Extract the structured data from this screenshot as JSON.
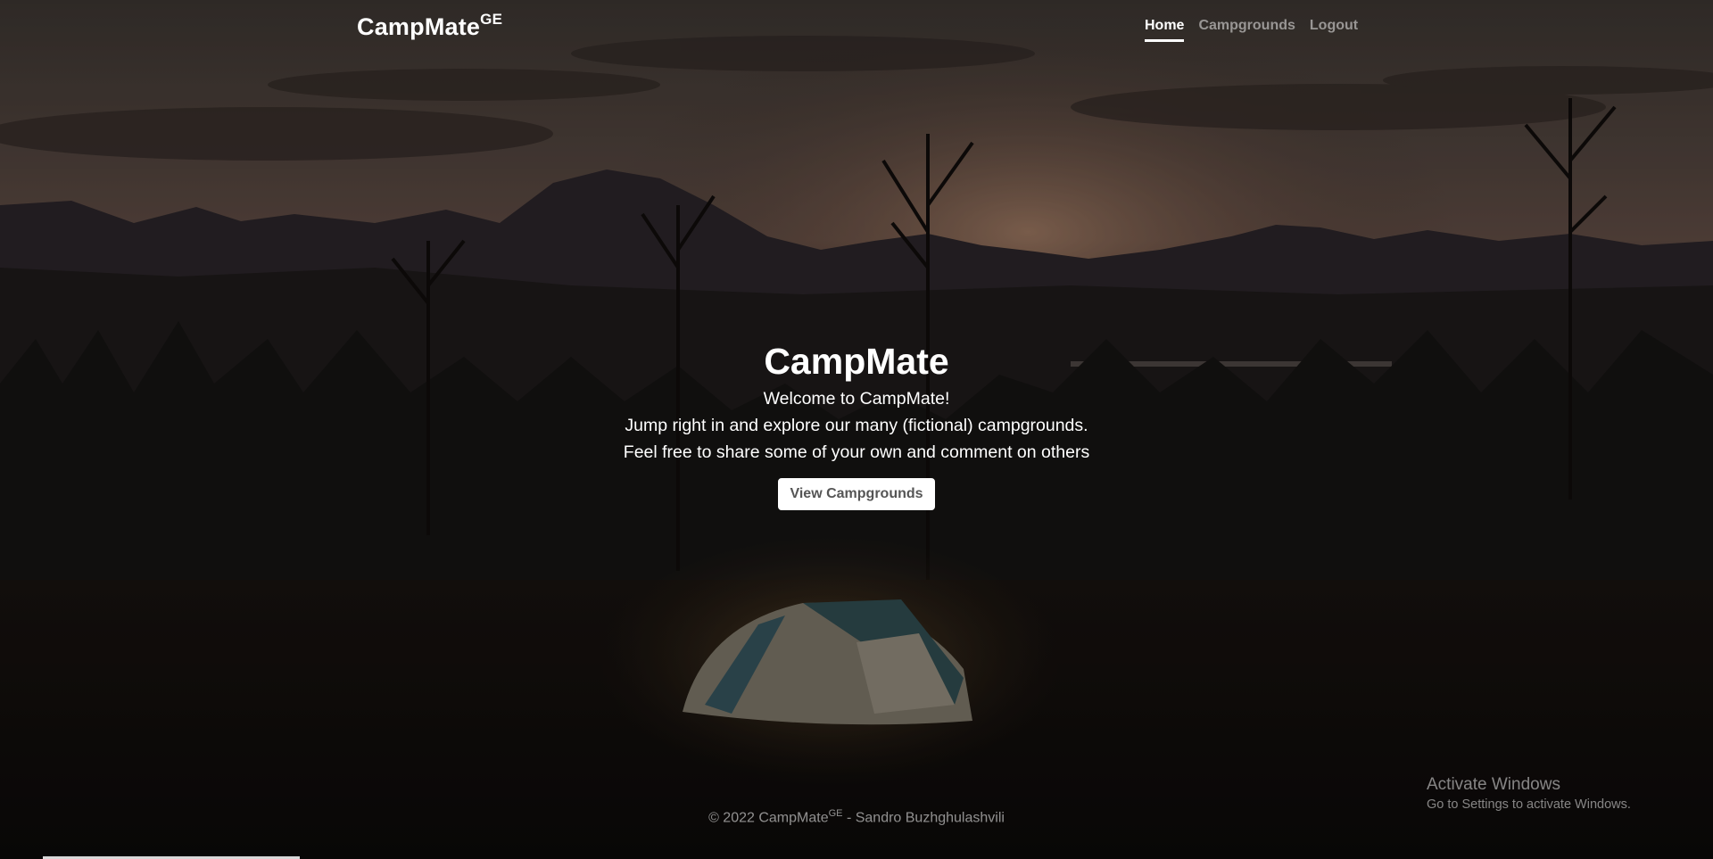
{
  "navbar": {
    "brand": "CampMate",
    "brand_sup": "GE",
    "links": [
      {
        "label": "Home",
        "active": true
      },
      {
        "label": "Campgrounds",
        "active": false
      },
      {
        "label": "Logout",
        "active": false
      }
    ]
  },
  "hero": {
    "title": "CampMate",
    "lines": [
      "Welcome to CampMate!",
      "Jump right in and explore our many (fictional) campgrounds.",
      "Feel free to share some of your own and comment on others"
    ],
    "button_label": "View Campgrounds"
  },
  "footer": {
    "prefix": "© 2022 CampMate",
    "sup": "GE",
    "suffix": " - Sandro Buzhghulashvili"
  },
  "watermark": {
    "title": "Activate Windows",
    "subtitle": "Go to Settings to activate Windows."
  },
  "colors": {
    "overlay": "#000000",
    "sky_warm": "#7a5a4a",
    "sun_glow": "#c9a58c",
    "text": "#ffffff",
    "nav_inactive": "#8a8a8a"
  }
}
